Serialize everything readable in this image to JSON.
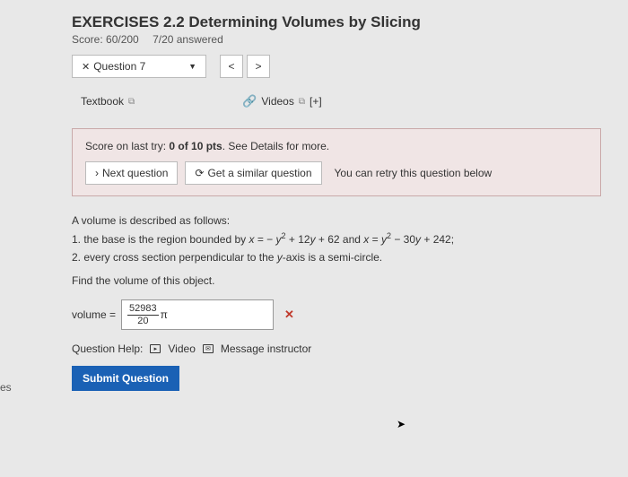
{
  "header": {
    "title": "EXERCISES 2.2 Determining Volumes by Slicing",
    "score": "Score: 60/200",
    "answered": "7/20 answered"
  },
  "nav": {
    "question_label": "Question 7",
    "prev": "<",
    "next": ">"
  },
  "resources": {
    "textbook": "Textbook",
    "videos": "Videos",
    "plus": "[+]"
  },
  "scorebox": {
    "prefix": "Score on last try: ",
    "bold": "0 of 10 pts",
    "suffix": ". See Details for more.",
    "next_btn": "Next question",
    "similar_btn": "Get a similar question",
    "retry": "You can retry this question below"
  },
  "problem": {
    "intro": "A volume is described as follows:",
    "line1_pre": "1.  the base is the region bounded by ",
    "line1_eq1_lhs": "x",
    "line1_eq1_rhs": " = − y² + 12y + 62",
    "line1_mid": " and ",
    "line1_eq2_lhs": "x",
    "line1_eq2_rhs": " = y² − 30y + 242;",
    "line2": "2.  every cross section perpendicular to the y-axis is a semi-circle.",
    "find": "Find the volume of this object."
  },
  "answer": {
    "label": "volume = ",
    "numerator": "52983",
    "denominator": "20",
    "pi": "π",
    "mark": "✕"
  },
  "help": {
    "label": "Question Help:",
    "video": "Video",
    "message": "Message instructor"
  },
  "submit": "Submit Question",
  "tab": "es"
}
